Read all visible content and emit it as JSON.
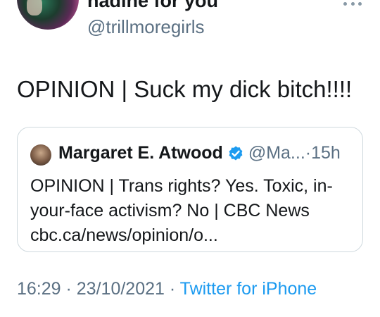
{
  "author": {
    "display_name": "nadine for you",
    "handle": "@trillmoregirls"
  },
  "tweet": {
    "text": "OPINION | Suck my dick bitch!!!!"
  },
  "quoted_tweet": {
    "display_name": "Margaret E. Atwood",
    "verified": true,
    "handle": "@Ma...",
    "separator": "·",
    "time": "15h",
    "lines": [
      "OPINION | Trans rights? Yes. Toxic, in-",
      "your-face activism? No | CBC News",
      "cbc.ca/news/opinion/o..."
    ]
  },
  "meta": {
    "time": "16:29",
    "sep1": " · ",
    "date": "23/10/2021",
    "sep2": " · ",
    "source": "Twitter for iPhone"
  },
  "colors": {
    "text": "#14171a",
    "secondary": "#5b7083",
    "link": "#1d9bf0",
    "verified": "#1d9bf0",
    "border": "#cfd9de"
  },
  "icons": [
    "more-icon",
    "verified-icon"
  ]
}
